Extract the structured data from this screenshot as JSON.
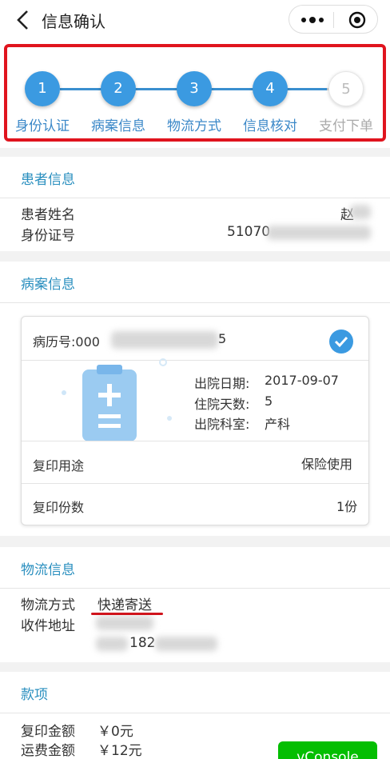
{
  "header": {
    "title": "信息确认",
    "back_icon": "back-arrow-icon",
    "more_icon": "more-dots-icon",
    "target_icon": "target-icon"
  },
  "steps": [
    {
      "number": "1",
      "label": "身份认证",
      "active": true
    },
    {
      "number": "2",
      "label": "病案信息",
      "active": true
    },
    {
      "number": "3",
      "label": "物流方式",
      "active": true
    },
    {
      "number": "4",
      "label": "信息核对",
      "active": true
    },
    {
      "number": "5",
      "label": "支付下单",
      "active": false
    }
  ],
  "patient": {
    "section_title": "患者信息",
    "name_label": "患者姓名",
    "name_value": "赵",
    "id_label": "身份证号",
    "id_value": "51070"
  },
  "record": {
    "section_title": "病案信息",
    "record_no_prefix": "病历号:000",
    "record_no_suffix": "5",
    "discharge_date_label": "出院日期:",
    "discharge_date": "2017-09-07",
    "stay_days_label": "住院天数:",
    "stay_days": "5",
    "department_label": "出院科室:",
    "department": "产科",
    "purpose_label": "复印用途",
    "purpose_value": "保险使用",
    "copies_label": "复印份数",
    "copies_value": "1份"
  },
  "logistics": {
    "section_title": "物流信息",
    "method_label": "物流方式",
    "method_value": "快递寄送",
    "address_label": "收件地址",
    "phone_partial": "182"
  },
  "payment": {
    "section_title": "款项",
    "copy_fee_label": "复印金额",
    "copy_fee_value": "￥0元",
    "shipping_fee_label": "运费金额",
    "shipping_fee_value": "￥12元"
  },
  "vconsole_label": "vConsole",
  "colors": {
    "accent": "#3b9ae1",
    "section_title": "#2a8fbf",
    "highlight": "#e0141e",
    "vconsole": "#04be02"
  }
}
